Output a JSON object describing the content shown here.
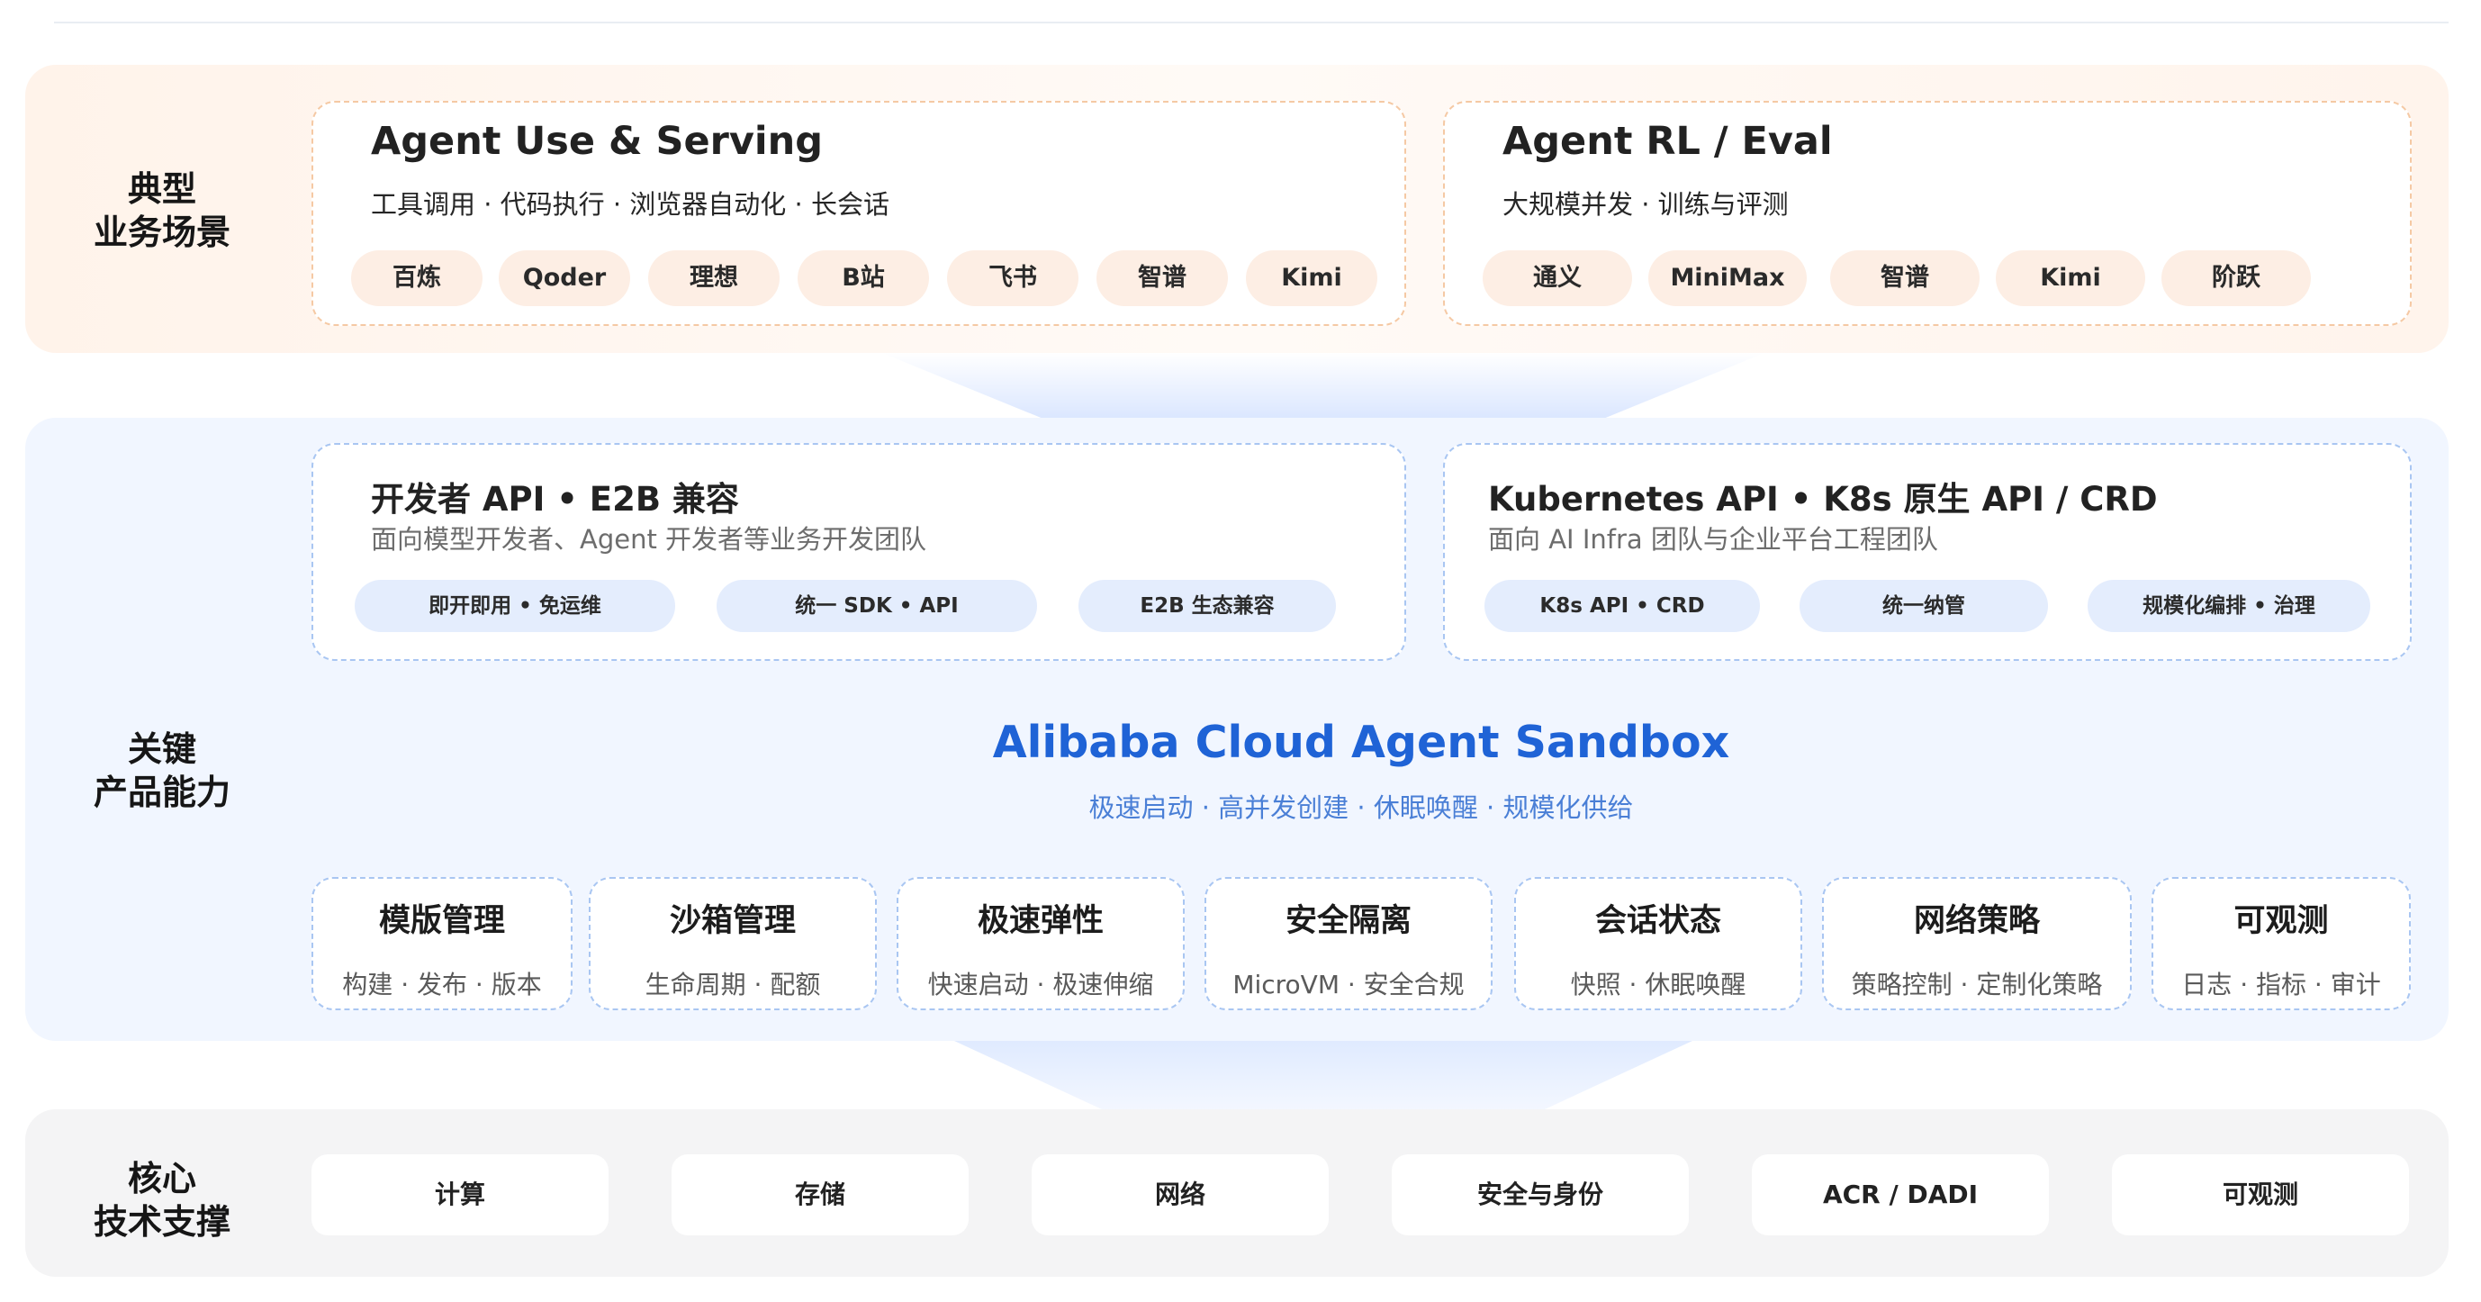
{
  "rows": {
    "scenarios_label": [
      "典型",
      "业务场景"
    ],
    "products_label": [
      "关键",
      "产品能力"
    ],
    "core_label": [
      "核心",
      "技术支撑"
    ]
  },
  "scenarios": {
    "use_serving": {
      "title": "Agent Use & Serving",
      "subtitle": "工具调用 · 代码执行 · 浏览器自动化 · 长会话",
      "customers": [
        "百炼",
        "Qoder",
        "理想",
        "B站",
        "飞书",
        "智谱",
        "Kimi"
      ]
    },
    "rl_eval": {
      "title": "Agent RL / Eval",
      "subtitle": "大规模并发 · 训练与评测",
      "customers": [
        "通义",
        "MiniMax",
        "智谱",
        "Kimi",
        "阶跃"
      ]
    }
  },
  "apis": {
    "developer": {
      "title": "开发者 API  •  E2B 兼容",
      "subtitle": "面向模型开发者、Agent 开发者等业务开发团队",
      "features": [
        "即开即用 • 免运维",
        "统一 SDK • API",
        "E2B 生态兼容"
      ]
    },
    "kubernetes": {
      "title": "Kubernetes API  •  K8s 原生 API / CRD",
      "subtitle": "面向 AI Infra 团队与企业平台工程团队",
      "features": [
        "K8s API • CRD",
        "统一纳管",
        "规模化编排 • 治理"
      ]
    }
  },
  "product": {
    "name": "Alibaba Cloud Agent Sandbox",
    "tagline": "极速启动 · 高并发创建 · 休眠唤醒 · 规模化供给",
    "name_color": "#1f63d6"
  },
  "capabilities": [
    {
      "title": "模版管理",
      "desc": "构建 · 发布 · 版本"
    },
    {
      "title": "沙箱管理",
      "desc": "生命周期 · 配额"
    },
    {
      "title": "极速弹性",
      "desc": "快速启动 · 极速伸缩"
    },
    {
      "title": "安全隔离",
      "desc": "MicroVM · 安全合规"
    },
    {
      "title": "会话状态",
      "desc": "快照 · 休眠唤醒"
    },
    {
      "title": "网络策略",
      "desc": "策略控制 · 定制化策略"
    },
    {
      "title": "可观测",
      "desc": "日志 · 指标 · 审计"
    }
  ],
  "core_tech": [
    "计算",
    "存储",
    "网络",
    "安全与身份",
    "ACR / DADI",
    "可观测"
  ]
}
